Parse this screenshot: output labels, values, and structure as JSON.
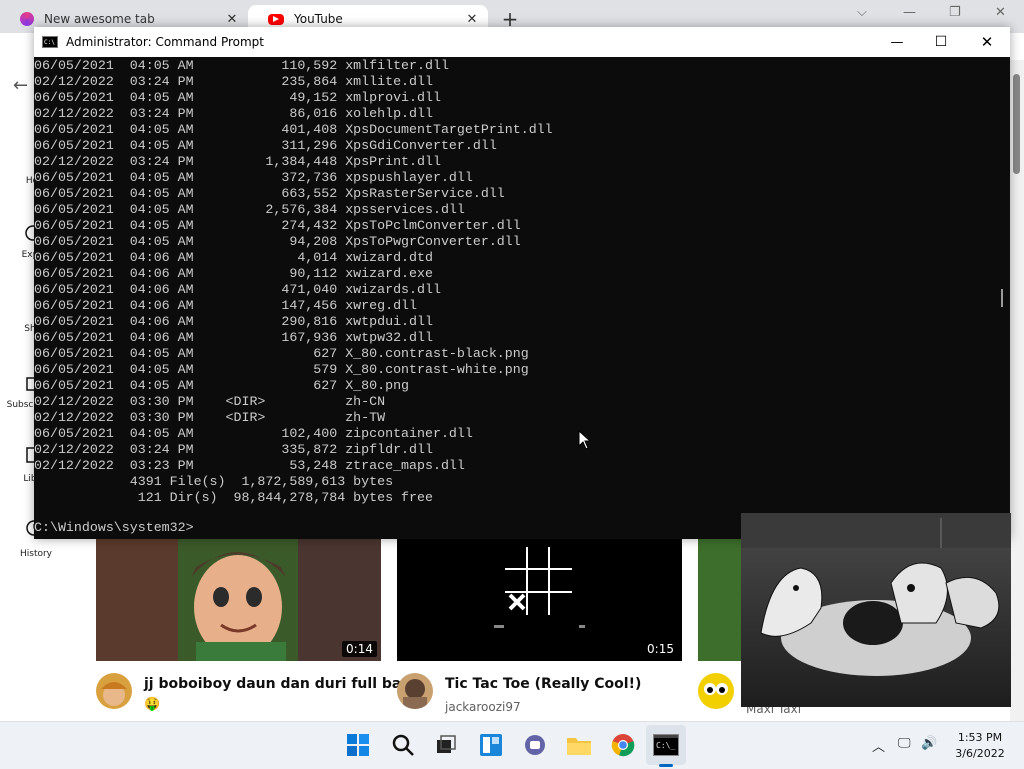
{
  "browser": {
    "tabs": [
      {
        "label": "New awesome tab",
        "close": "✕",
        "icon": "awesome-tab-icon"
      },
      {
        "label": "YouTube",
        "close": "✕",
        "icon": "youtube-icon",
        "active": true
      }
    ],
    "new_tab": "+",
    "window_controls": {
      "chevron": "⌵",
      "minimize": "—",
      "restore": "❐",
      "close": "✕"
    },
    "back": "←"
  },
  "youtube": {
    "sidebar": [
      {
        "label": "Ho",
        "icon": "home-icon"
      },
      {
        "label": "Exp",
        "icon": "explore-icon"
      },
      {
        "label": "Sh",
        "icon": "shorts-icon"
      },
      {
        "label": "Subsc",
        "icon": "subscriptions-icon"
      },
      {
        "label": "Lib",
        "icon": "library-icon"
      },
      {
        "label": "History",
        "icon": "history-icon"
      }
    ],
    "videos": [
      {
        "title": "jj boboiboy daun dan duri full bas",
        "channel": "🤑",
        "duration": "0:14"
      },
      {
        "title": "Tic Tac Toe (Really Cool!)",
        "channel": "jackaroozi97",
        "duration": "0:15"
      },
      {
        "title": "",
        "channel": "Maxi Taxi",
        "duration": ""
      }
    ]
  },
  "cmd": {
    "title": "Administrator: Command Prompt",
    "icon_text": "C:\\",
    "controls": {
      "minimize": "—",
      "maximize": "☐",
      "close": "✕"
    },
    "lines": [
      "06/05/2021  04:05 AM           110,592 xmlfilter.dll",
      "02/12/2022  03:24 PM           235,864 xmllite.dll",
      "06/05/2021  04:05 AM            49,152 xmlprovi.dll",
      "02/12/2022  03:24 PM            86,016 xolehlp.dll",
      "06/05/2021  04:05 AM           401,408 XpsDocumentTargetPrint.dll",
      "06/05/2021  04:05 AM           311,296 XpsGdiConverter.dll",
      "02/12/2022  03:24 PM         1,384,448 XpsPrint.dll",
      "06/05/2021  04:05 AM           372,736 xpspushlayer.dll",
      "06/05/2021  04:05 AM           663,552 XpsRasterService.dll",
      "06/05/2021  04:05 AM         2,576,384 xpsservices.dll",
      "06/05/2021  04:05 AM           274,432 XpsToPclmConverter.dll",
      "06/05/2021  04:05 AM            94,208 XpsToPwgrConverter.dll",
      "06/05/2021  04:06 AM             4,014 xwizard.dtd",
      "06/05/2021  04:06 AM            90,112 xwizard.exe",
      "06/05/2021  04:06 AM           471,040 xwizards.dll",
      "06/05/2021  04:06 AM           147,456 xwreg.dll",
      "06/05/2021  04:06 AM           290,816 xwtpdui.dll",
      "06/05/2021  04:06 AM           167,936 xwtpw32.dll",
      "06/05/2021  04:05 AM               627 X_80.contrast-black.png",
      "06/05/2021  04:05 AM               579 X_80.contrast-white.png",
      "06/05/2021  04:05 AM               627 X_80.png",
      "02/12/2022  03:30 PM    <DIR>          zh-CN",
      "02/12/2022  03:30 PM    <DIR>          zh-TW",
      "06/05/2021  04:05 AM           102,400 zipcontainer.dll",
      "02/12/2022  03:24 PM           335,872 zipfldr.dll",
      "02/12/2022  03:23 PM            53,248 ztrace_maps.dll",
      "            4391 File(s)  1,872,589,613 bytes",
      "             121 Dir(s)  98,844,278,784 bytes free",
      ""
    ],
    "prompt": "C:\\Windows\\system32>"
  },
  "taskbar": {
    "icons": [
      "start-icon",
      "search-icon",
      "task-view-icon",
      "widgets-icon",
      "teams-chat-icon",
      "file-explorer-icon",
      "chrome-icon",
      "command-prompt-icon"
    ],
    "tray": {
      "chevron": "︿",
      "network": "🖵",
      "volume": "🔊"
    },
    "time": "1:53 PM",
    "date": "3/6/2022"
  }
}
